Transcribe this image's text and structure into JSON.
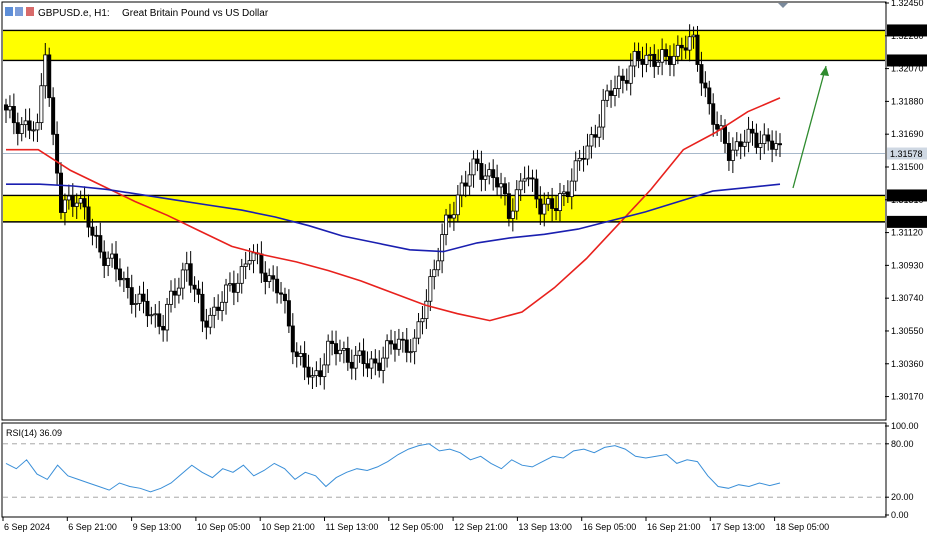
{
  "header": {
    "symbol_label": "GBPUSD.e, H1:",
    "description": "Great Britain Pound vs US Dollar"
  },
  "colors": {
    "bull_candle": "#000000",
    "bear_candle": "#000000",
    "ma_fast": "#e8211d",
    "ma_slow": "#1a1fb0",
    "zone_fill": "#ffff00",
    "arrow": "#2e8b2e",
    "rsi_line": "#3a8fd8",
    "background": "#ffffff"
  },
  "chart_data": [
    {
      "type": "candlestick",
      "title": "GBPUSD.e, H1: Great Britain Pound vs US Dollar",
      "ylim": [
        1.3004,
        1.3245
      ],
      "y_ticks": [
        1.3245,
        1.3226,
        1.3207,
        1.3188,
        1.3169,
        1.315,
        1.3131,
        1.3112,
        1.3093,
        1.3074,
        1.3055,
        1.3036,
        1.3017
      ],
      "price_labels": [
        {
          "value": "1.32291",
          "level": 1.32291
        },
        {
          "value": "1.32117",
          "level": 1.32117
        },
        {
          "value": "1.31578",
          "level": 1.31578
        },
        {
          "value": "1.31335",
          "level": 1.31335
        },
        {
          "value": "1.31182",
          "level": 1.31182
        }
      ],
      "x_labels": [
        "6 Sep 2024",
        "6 Sep 21:00",
        "9 Sep 13:00",
        "10 Sep 05:00",
        "10 Sep 21:00",
        "11 Sep 13:00",
        "12 Sep 05:00",
        "12 Sep 21:00",
        "13 Sep 13:00",
        "16 Sep 05:00",
        "16 Sep 21:00",
        "17 Sep 13:00",
        "18 Sep 05:00"
      ],
      "zones": [
        {
          "from": 1.32117,
          "to": 1.32291
        },
        {
          "from": 1.31182,
          "to": 1.31335
        }
      ],
      "key": [
        {
          "time": 0,
          "price": 1.318
        },
        {
          "time": 8,
          "price": 1.317
        },
        {
          "time": 10,
          "price": 1.3222
        },
        {
          "time": 12,
          "price": 1.3165
        },
        {
          "time": 14,
          "price": 1.3125
        },
        {
          "time": 18,
          "price": 1.3135
        },
        {
          "time": 22,
          "price": 1.311
        },
        {
          "time": 28,
          "price": 1.309
        },
        {
          "time": 34,
          "price": 1.307
        },
        {
          "time": 40,
          "price": 1.306
        },
        {
          "time": 46,
          "price": 1.3095
        },
        {
          "time": 50,
          "price": 1.306
        },
        {
          "time": 56,
          "price": 1.3075
        },
        {
          "time": 62,
          "price": 1.3098
        },
        {
          "time": 66,
          "price": 1.309
        },
        {
          "time": 70,
          "price": 1.3075
        },
        {
          "time": 74,
          "price": 1.3042
        },
        {
          "time": 78,
          "price": 1.3025
        },
        {
          "time": 82,
          "price": 1.3045
        },
        {
          "time": 88,
          "price": 1.304
        },
        {
          "time": 92,
          "price": 1.3035
        },
        {
          "time": 96,
          "price": 1.304
        },
        {
          "time": 100,
          "price": 1.305
        },
        {
          "time": 104,
          "price": 1.3045
        },
        {
          "time": 108,
          "price": 1.3085
        },
        {
          "time": 112,
          "price": 1.3115
        },
        {
          "time": 116,
          "price": 1.314
        },
        {
          "time": 120,
          "price": 1.315
        },
        {
          "time": 124,
          "price": 1.3145
        },
        {
          "time": 128,
          "price": 1.3125
        },
        {
          "time": 132,
          "price": 1.3145
        },
        {
          "time": 136,
          "price": 1.313
        },
        {
          "time": 140,
          "price": 1.3125
        },
        {
          "time": 144,
          "price": 1.3145
        },
        {
          "time": 148,
          "price": 1.316
        },
        {
          "time": 152,
          "price": 1.3185
        },
        {
          "time": 156,
          "price": 1.32
        },
        {
          "time": 160,
          "price": 1.321
        },
        {
          "time": 164,
          "price": 1.3215
        },
        {
          "time": 168,
          "price": 1.321
        },
        {
          "time": 172,
          "price": 1.3222
        },
        {
          "time": 175,
          "price": 1.322
        },
        {
          "time": 178,
          "price": 1.3195
        },
        {
          "time": 181,
          "price": 1.317
        },
        {
          "time": 184,
          "price": 1.316
        },
        {
          "time": 188,
          "price": 1.3165
        },
        {
          "time": 192,
          "price": 1.3168
        },
        {
          "time": 195,
          "price": 1.3162
        },
        {
          "time": 197,
          "price": 1.3158
        }
      ],
      "series": [
        {
          "name": "Fast MA",
          "values": [
            1.316,
            1.316,
            1.3148,
            1.3139,
            1.313,
            1.3122,
            1.3113,
            1.3104,
            1.3099,
            1.3095,
            1.309,
            1.3084,
            1.3077,
            1.307,
            1.3065,
            1.3061,
            1.3066,
            1.308,
            1.3097,
            1.3117,
            1.3137,
            1.316,
            1.317,
            1.3182,
            1.319
          ]
        },
        {
          "name": "Slow MA",
          "values": [
            1.314,
            1.314,
            1.3139,
            1.3137,
            1.3134,
            1.3131,
            1.3128,
            1.3125,
            1.3121,
            1.3116,
            1.311,
            1.3106,
            1.3102,
            1.3101,
            1.3106,
            1.3109,
            1.3111,
            1.3114,
            1.3119,
            1.3124,
            1.313,
            1.3136,
            1.3138,
            1.314
          ]
        }
      ]
    },
    {
      "type": "line",
      "title": "RSI(14) 36.09",
      "ylim": [
        0,
        100
      ],
      "y_ticks": [
        "100.00",
        "80.00",
        "20.00",
        "0.00"
      ],
      "levels": [
        80,
        20
      ],
      "series": [
        {
          "name": "RSI(14)",
          "values": [
            58,
            52,
            62,
            46,
            40,
            56,
            44,
            40,
            36,
            32,
            28,
            36,
            32,
            30,
            26,
            30,
            36,
            46,
            56,
            48,
            42,
            52,
            48,
            56,
            44,
            50,
            58,
            52,
            40,
            48,
            44,
            32,
            42,
            48,
            52,
            50,
            54,
            60,
            68,
            74,
            78,
            80,
            72,
            74,
            70,
            62,
            66,
            58,
            52,
            62,
            56,
            54,
            60,
            66,
            64,
            72,
            74,
            70,
            76,
            78,
            74,
            66,
            64,
            66,
            68,
            58,
            62,
            60,
            44,
            32,
            30,
            34,
            32,
            36,
            33,
            36
          ]
        }
      ]
    }
  ],
  "rsi_label": "RSI(14) 36.09"
}
